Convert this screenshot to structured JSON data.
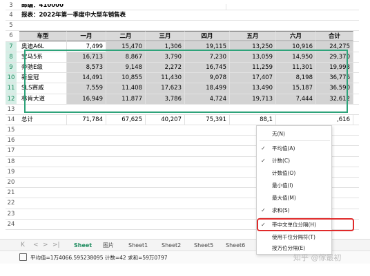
{
  "rows": {
    "r3": {
      "n": "3",
      "a": "邮编：410000"
    },
    "r4": {
      "n": "4",
      "a": "报表：2022年第一季度中大型车销售表"
    },
    "r5": {
      "n": "5"
    },
    "r6": {
      "n": "6",
      "h": [
        "车型",
        "一月",
        "二月",
        "三月",
        "四月",
        "五月",
        "六月",
        "合计"
      ]
    },
    "data": [
      {
        "n": "7",
        "name": "奥迪A6L",
        "v": [
          "7,499",
          "15,470",
          "1,306",
          "19,115",
          "13,250",
          "10,916",
          "24,275"
        ]
      },
      {
        "n": "8",
        "name": "宝马5系",
        "v": [
          "16,713",
          "8,867",
          "3,790",
          "7,230",
          "13,059",
          "14,950",
          "29,370"
        ]
      },
      {
        "n": "9",
        "name": "奔驰E级",
        "v": [
          "8,573",
          "9,148",
          "2,272",
          "16,745",
          "11,259",
          "11,301",
          "19,993"
        ]
      },
      {
        "n": "10",
        "name": "新皇冠",
        "v": [
          "14,491",
          "10,855",
          "11,430",
          "9,078",
          "17,407",
          "8,198",
          "36,776"
        ]
      },
      {
        "n": "11",
        "name": "SLS赛威",
        "v": [
          "7,559",
          "11,408",
          "17,623",
          "18,499",
          "13,490",
          "15,187",
          "36,590"
        ]
      },
      {
        "n": "12",
        "name": "林肯大道",
        "v": [
          "16,949",
          "11,877",
          "3,786",
          "4,724",
          "19,713",
          "7,444",
          "32,612"
        ]
      }
    ],
    "r13": {
      "n": "13"
    },
    "r14": {
      "n": "14",
      "name": "总计",
      "v": [
        "71,784",
        "67,625",
        "40,207",
        "75,391",
        "88,1"
      ],
      "last": ",616"
    },
    "empty": [
      "15",
      "16",
      "17",
      "18",
      "19",
      "20",
      "21",
      "22",
      "23",
      "24"
    ]
  },
  "tabs": {
    "nav": [
      "K",
      "<",
      ">",
      ">|"
    ],
    "items": [
      "Sheet",
      "图片",
      "Sheet1",
      "Sheet2",
      "Sheet5",
      "Sheet6"
    ]
  },
  "status": {
    "text": "平均值=1万4066.595238095  计数=42  求和=59万0797"
  },
  "menu": [
    {
      "label": "无(N)",
      "checked": false
    },
    {
      "label": "平均值(A)",
      "checked": true
    },
    {
      "label": "计数(C)",
      "checked": true
    },
    {
      "label": "计数值(O)",
      "checked": false
    },
    {
      "label": "最小值(I)",
      "checked": false
    },
    {
      "label": "最大值(M)",
      "checked": false
    },
    {
      "label": "求和(S)",
      "checked": true
    },
    {
      "label": "带中文单位分隔(H)",
      "checked": true
    },
    {
      "label": "使用千位分隔符(T)",
      "checked": false
    },
    {
      "label": "按万位分隔(E)",
      "checked": false
    }
  ],
  "watermark": "知乎 @傢最初",
  "colors": {
    "accent": "#1a8a5c",
    "highlight": "#e02a2a",
    "selection": "#d3d3d3"
  }
}
